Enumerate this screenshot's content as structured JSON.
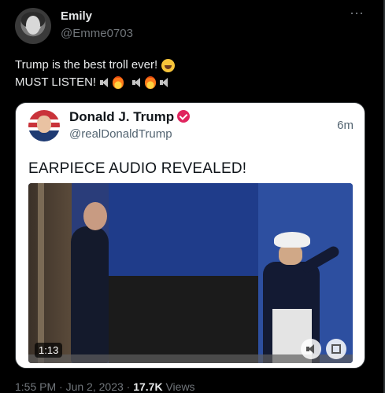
{
  "author": {
    "display_name": "Emily",
    "handle": "@Emme0703"
  },
  "more_icon": "⋯",
  "tweet": {
    "line1": "Trump is the best troll ever!",
    "line2": "MUST LISTEN!"
  },
  "quoted": {
    "display_name": "Donald J. Trump",
    "handle": "@realDonaldTrump",
    "time_ago": "6m",
    "text": "EARPIECE AUDIO REVEALED!",
    "video": {
      "duration": "1:13"
    }
  },
  "footer": {
    "time": "1:55 PM",
    "sep1": " · ",
    "date": "Jun 2, 2023",
    "sep2": " · ",
    "views_count": "17.7K",
    "views_label": " Views"
  },
  "icons": [
    "avatar",
    "laughing-emoji-icon",
    "speaker-icon",
    "fire-emoji-icon",
    "verified-badge-icon",
    "volume-icon",
    "fullscreen-icon"
  ],
  "colors": {
    "background": "#000000",
    "text": "#e7e9ea",
    "muted": "#71767b",
    "badge": "#e0245e"
  }
}
